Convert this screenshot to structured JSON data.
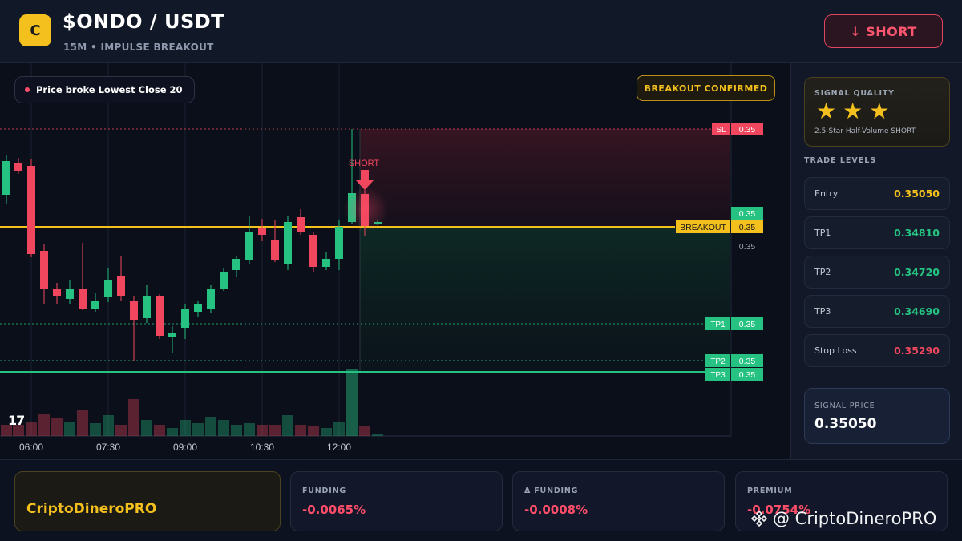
{
  "header": {
    "logo_letter": "C",
    "pair": "$ONDO / USDT",
    "subtitle": "15M • IMPULSE BREAKOUT",
    "short_button": "↓ SHORT"
  },
  "chart": {
    "badge_left": "Price broke Lowest Close 20",
    "badge_right": "BREAKOUT CONFIRMED",
    "short_marker": "SHORT",
    "tv_logo": "17",
    "time_labels": [
      "06:00",
      "07:30",
      "09:00",
      "10:30",
      "12:00"
    ],
    "price_labels": {
      "sl_tag": "SL",
      "sl_value": "0.35",
      "current_value": "0.35",
      "breakout_tag": "BREAKOUT",
      "breakout_value": "0.35",
      "axis_value": "0.35",
      "tp1_tag": "TP1",
      "tp1_value": "0.35",
      "tp2_tag": "TP2",
      "tp2_value": "0.35",
      "tp3_tag": "TP3",
      "tp3_value": "0.35"
    },
    "colors": {
      "up": "#26c281",
      "down": "#f0475e",
      "breakout": "#f3c01e",
      "sl": "#f0475e",
      "tp": "#26c281"
    }
  },
  "sidebar": {
    "signal_quality_label": "SIGNAL QUALITY",
    "stars": "★★★",
    "signal_quality_desc": "2.5-Star Half-Volume SHORT",
    "trade_levels_label": "TRADE LEVELS",
    "levels": [
      {
        "label": "Entry",
        "value": "0.35050",
        "color": "#f3c01e"
      },
      {
        "label": "TP1",
        "value": "0.34810",
        "color": "#26c281"
      },
      {
        "label": "TP2",
        "value": "0.34720",
        "color": "#26c281"
      },
      {
        "label": "TP3",
        "value": "0.34690",
        "color": "#26c281"
      },
      {
        "label": "Stop Loss",
        "value": "0.35290",
        "color": "#f0475e"
      }
    ],
    "signal_price_label": "SIGNAL PRICE",
    "signal_price": "0.35050"
  },
  "footer": {
    "brand": "CriptoDineroPRO",
    "funding_label": "FUNDING",
    "funding_value": "-0.0065%",
    "dfunding_label": "Δ FUNDING",
    "dfunding_value": "-0.0008%",
    "premium_label": "PREMIUM",
    "premium_value": "-0.0754%",
    "watermark": "@ CriptoDineroPRO"
  }
}
